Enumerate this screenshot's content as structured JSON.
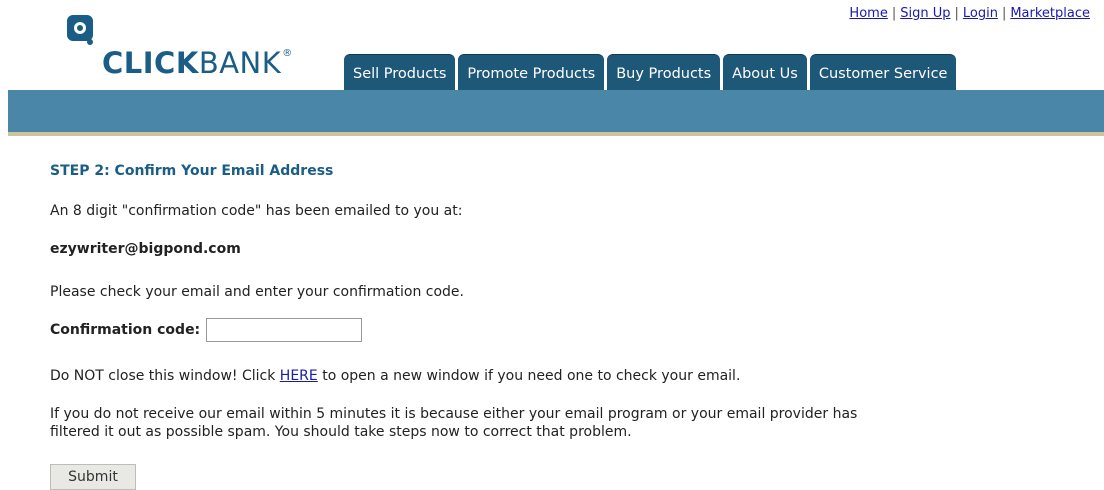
{
  "top_links": [
    "Home",
    "Sign Up",
    "Login",
    "Marketplace"
  ],
  "logo": {
    "part1": "CLICK",
    "part2": "BANK",
    "reg": "®"
  },
  "tabs": [
    "Sell Products",
    "Promote Products",
    "Buy Products",
    "About Us",
    "Customer Service"
  ],
  "content": {
    "step_title": "STEP 2: Confirm Your Email Address",
    "intro": "An 8 digit \"confirmation code\" has been emailed to you at:",
    "email": "ezywriter@bigpond.com",
    "instruction": "Please check your email and enter your confirmation code.",
    "code_label": "Confirmation code:",
    "code_value": "",
    "warn_before": "Do NOT close this window! Click ",
    "warn_link": "HERE",
    "warn_after": " to open a new window if you need one to check your email.",
    "spam_line1": "If you do not receive our email within 5 minutes it is because either your email program or your email provider has",
    "spam_line2": "filtered it out as possible spam. You should take steps now to correct that problem.",
    "submit_label": "Submit"
  },
  "colors": {
    "brand": "#1a5d87",
    "tab_bg": "#1e5878",
    "band": "#4a86a8",
    "band_line": "#cfc39c"
  }
}
